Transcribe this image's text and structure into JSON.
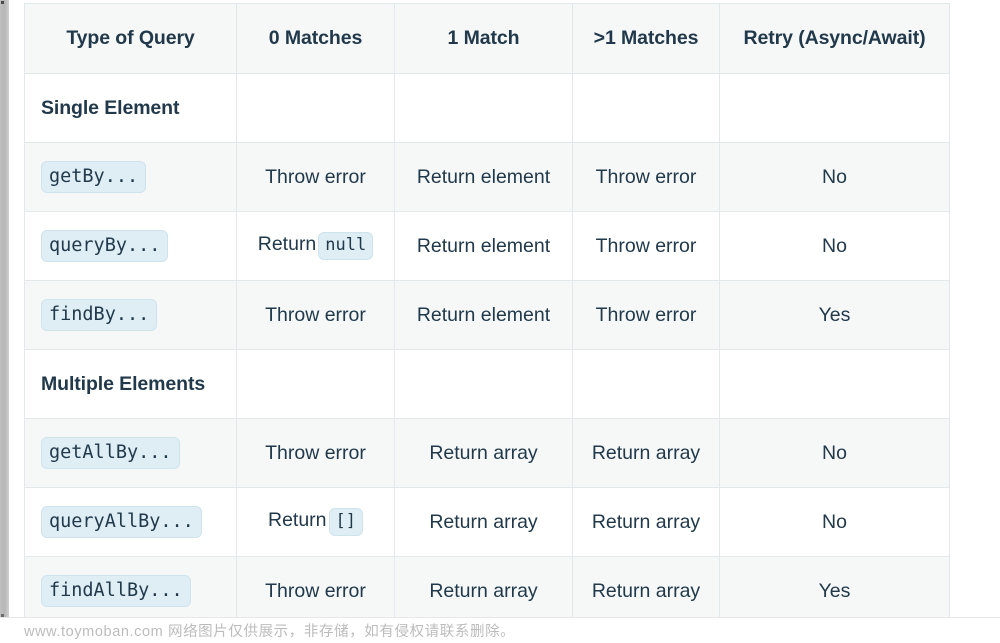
{
  "table": {
    "columns": [
      "Type of Query",
      "0 Matches",
      "1 Match",
      ">1 Matches",
      "Retry (Async/Await)"
    ],
    "rows": [
      {
        "kind": "section",
        "label": "Single Element",
        "cells": [
          "",
          "",
          "",
          ""
        ]
      },
      {
        "kind": "query",
        "chip": "getBy...",
        "cells": [
          "Throw error",
          "Return element",
          "Throw error",
          "No"
        ]
      },
      {
        "kind": "query",
        "chip": "queryBy...",
        "cells": [
          "Return",
          "Return element",
          "Throw error",
          "No"
        ],
        "cell0_chip": "null"
      },
      {
        "kind": "query",
        "chip": "findBy...",
        "cells": [
          "Throw error",
          "Return element",
          "Throw error",
          "Yes"
        ]
      },
      {
        "kind": "section",
        "label": "Multiple Elements",
        "cells": [
          "",
          "",
          "",
          ""
        ]
      },
      {
        "kind": "query",
        "chip": "getAllBy...",
        "cells": [
          "Throw error",
          "Return array",
          "Return array",
          "No"
        ]
      },
      {
        "kind": "query",
        "chip": "queryAllBy...",
        "cells": [
          "Return",
          "Return array",
          "Return array",
          "No"
        ],
        "cell0_chip": "[]"
      },
      {
        "kind": "query",
        "chip": "findAllBy...",
        "cells": [
          "Throw error",
          "Return array",
          "Return array",
          "Yes"
        ]
      }
    ]
  },
  "watermark": {
    "text": "www.toymoban.com 网络图片仅供展示，非存储，如有侵权请联系删除。"
  },
  "colors": {
    "text": "#21394a",
    "header_bg": "#f6f8f8",
    "stripe_bg": "#f6f8f8",
    "row_bg": "#ffffff",
    "border": "#e3e8ea",
    "chip_bg": "#dfeef5",
    "chip_border": "#cfe3ec",
    "watermark_text": "#bcbcbc"
  }
}
